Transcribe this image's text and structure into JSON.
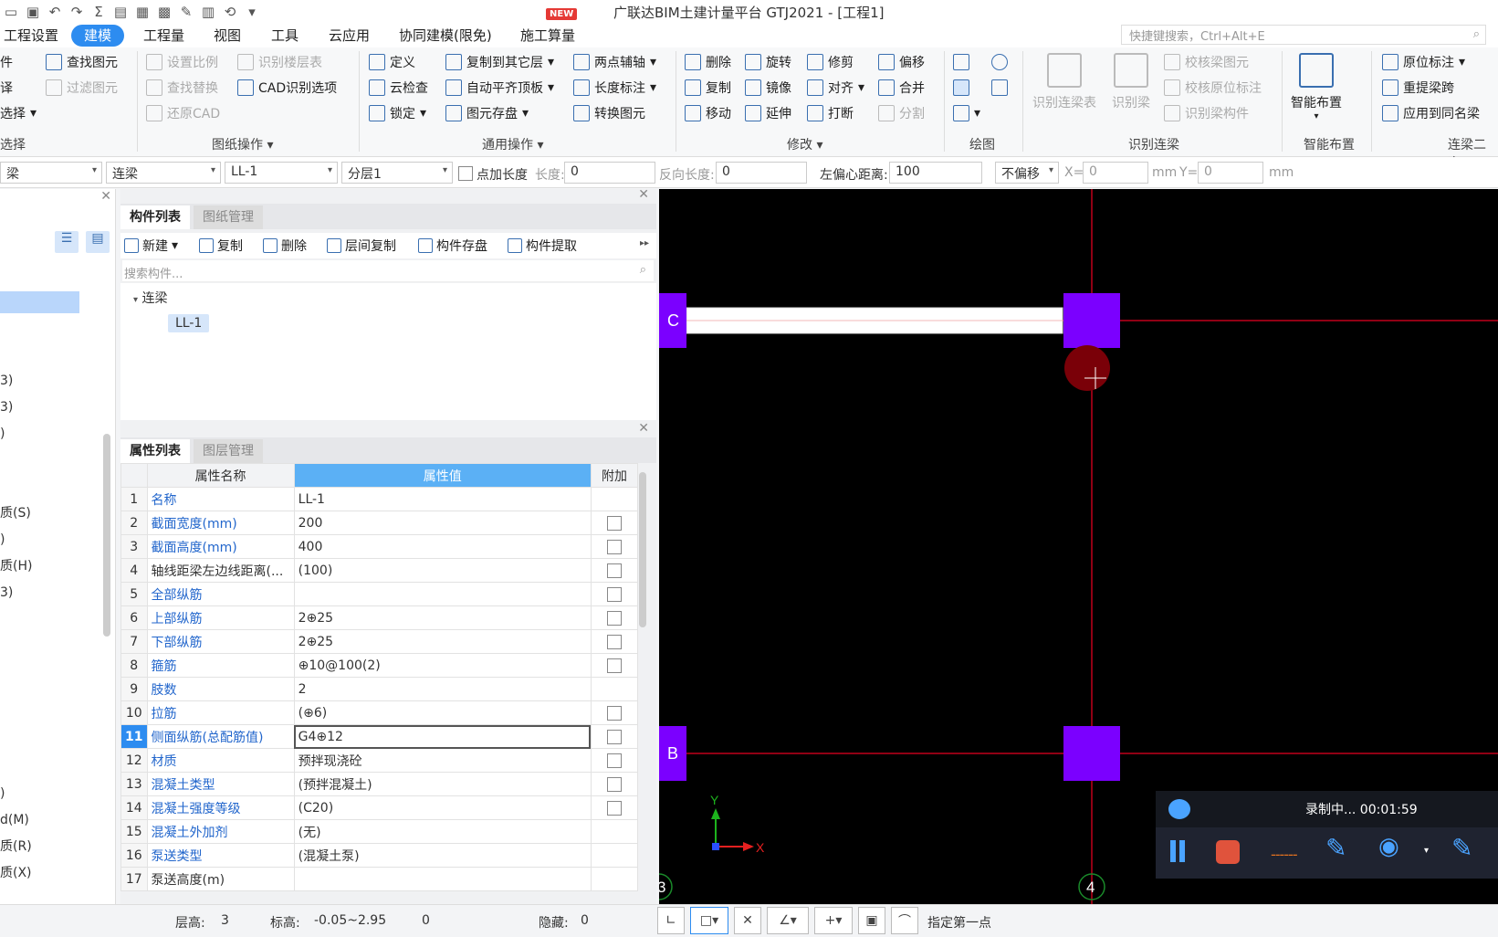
{
  "titlebar": {
    "title": "广联达BIM土建计量平台 GTJ2021 - [工程1]",
    "new_badge": "NEW"
  },
  "menu": {
    "tabs": [
      "工程设置",
      "建模",
      "工程量",
      "视图",
      "工具",
      "云应用",
      "协同建模(限免)",
      "施工算量"
    ],
    "active": "建模",
    "search_placeholder": "快捷键搜索，Ctrl+Alt+E"
  },
  "ribbon": {
    "select": {
      "find": "查找图元",
      "filter": "过滤图元",
      "select": "选择",
      "group": "选择"
    },
    "drawing": {
      "set_scale": "设置比例",
      "identify_floor": "识别楼层表",
      "find_replace": "查找替换",
      "cad_options": "CAD识别选项",
      "restore_cad": "还原CAD",
      "group": "图纸操作"
    },
    "common": {
      "define": "定义",
      "copy_other": "复制到其它层",
      "two_point": "两点辅轴",
      "cloud_check": "云检查",
      "auto_level": "自动平齐顶板",
      "length_mark": "长度标注",
      "lock": "锁定",
      "save_elem": "图元存盘",
      "convert": "转换图元",
      "group": "通用操作"
    },
    "modify": {
      "delete": "删除",
      "rotate": "旋转",
      "trim": "修剪",
      "offset": "偏移",
      "copy": "复制",
      "mirror": "镜像",
      "align": "对齐",
      "merge": "合并",
      "move": "移动",
      "extend": "延伸",
      "break": "打断",
      "split": "分割",
      "group": "修改"
    },
    "draw": {
      "group": "绘图"
    },
    "identify": {
      "identify_table": "识别连梁表",
      "identify_beam": "识别梁",
      "check_beam": "校核梁图元",
      "check_mark": "校核原位标注",
      "identify_comp": "识别梁构件",
      "group": "识别连梁"
    },
    "smart": {
      "label": "智能布置",
      "group": "智能布置"
    },
    "beam2": {
      "in_place": "原位标注",
      "re_span": "重提梁跨",
      "apply_same": "应用到同名梁",
      "group": "连梁二次"
    }
  },
  "propbar": {
    "type": "梁",
    "sub": "连梁",
    "name": "LL-1",
    "layer": "分层1",
    "add_len_label": "点加长度",
    "len_label": "长度:",
    "len_val": "0",
    "rev_label": "反向长度:",
    "rev_val": "0",
    "offset_label": "左偏心距离:",
    "offset_val": "100",
    "no_offset": "不偏移",
    "x_label": "X=",
    "x_val": "0",
    "mm1": "mm",
    "y_label": "Y=",
    "y_val": "0",
    "mm2": "mm"
  },
  "left_partial": [
    "件",
    "译",
    "选择",
    "选择",
    "3)",
    "3)",
    ")",
    "质(S)",
    ")",
    "质(H)",
    "3)",
    ")",
    "d(M)",
    "质(R)",
    "质(X)"
  ],
  "components": {
    "tabs": [
      "构件列表",
      "图纸管理"
    ],
    "new": "新建",
    "copy": "复制",
    "delete": "删除",
    "layer_copy": "层间复制",
    "save": "构件存盘",
    "extract": "构件提取",
    "search": "搜索构件...",
    "tree_root": "连梁",
    "tree_item": "LL-1"
  },
  "props": {
    "tabs": [
      "属性列表",
      "图层管理"
    ],
    "headers": [
      "属性名称",
      "属性值",
      "附加"
    ],
    "rows": [
      {
        "n": "1",
        "k": "名称",
        "v": "LL-1",
        "blue": true,
        "cb": false
      },
      {
        "n": "2",
        "k": "截面宽度(mm)",
        "v": "200",
        "blue": true,
        "cb": true
      },
      {
        "n": "3",
        "k": "截面高度(mm)",
        "v": "400",
        "blue": true,
        "cb": true
      },
      {
        "n": "4",
        "k": "轴线距梁左边线距离(...",
        "v": "(100)",
        "blue": false,
        "cb": true
      },
      {
        "n": "5",
        "k": "全部纵筋",
        "v": "",
        "blue": true,
        "cb": true
      },
      {
        "n": "6",
        "k": "上部纵筋",
        "v": "2⊕25",
        "blue": true,
        "cb": true
      },
      {
        "n": "7",
        "k": "下部纵筋",
        "v": "2⊕25",
        "blue": true,
        "cb": true
      },
      {
        "n": "8",
        "k": "箍筋",
        "v": "⊕10@100(2)",
        "blue": true,
        "cb": true
      },
      {
        "n": "9",
        "k": "肢数",
        "v": "2",
        "blue": true,
        "cb": false
      },
      {
        "n": "10",
        "k": "拉筋",
        "v": "(⊕6)",
        "blue": true,
        "cb": true
      },
      {
        "n": "11",
        "k": "侧面纵筋(总配筋值)",
        "v": "G4⊕12",
        "blue": true,
        "cb": true
      },
      {
        "n": "12",
        "k": "材质",
        "v": "预拌现浇砼",
        "blue": true,
        "cb": true
      },
      {
        "n": "13",
        "k": "混凝土类型",
        "v": "(预拌混凝土)",
        "blue": true,
        "cb": true
      },
      {
        "n": "14",
        "k": "混凝土强度等级",
        "v": "(C20)",
        "blue": true,
        "cb": true
      },
      {
        "n": "15",
        "k": "混凝土外加剂",
        "v": "(无)",
        "blue": true,
        "cb": false
      },
      {
        "n": "16",
        "k": "泵送类型",
        "v": "(混凝土泵)",
        "blue": true,
        "cb": false
      },
      {
        "n": "17",
        "k": "泵送高度(m)",
        "v": "",
        "blue": false,
        "cb": false
      }
    ],
    "selected_row": "11"
  },
  "canvas": {
    "axis_c": "C",
    "axis_b": "B",
    "axis_4": "4",
    "axis_3": "3",
    "x": "X",
    "y": "Y"
  },
  "recorder": {
    "status": "录制中... 00:01:59"
  },
  "status": {
    "floor_h_label": "层高:",
    "floor_h": "3",
    "elev_label": "标高:",
    "elev": "-0.05~2.95",
    "count": "0",
    "hidden_label": "隐藏:",
    "hidden": "0",
    "prompt": "指定第一点"
  }
}
